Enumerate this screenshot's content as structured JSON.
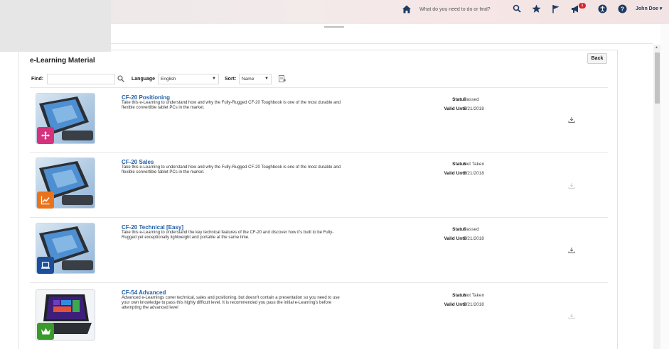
{
  "header": {
    "search_placeholder": "What do you need to do or find?",
    "notification_count": "1",
    "user_name": "John Doe ▾"
  },
  "page": {
    "title": "e-Learning Material",
    "back_label": "Back"
  },
  "filters": {
    "find_label": "Find:",
    "find_value": "",
    "language_label": "Language",
    "language_value": "English",
    "sort_label": "Sort:",
    "sort_value": "Name"
  },
  "meta_labels": {
    "status": "Status",
    "valid_until": "Valid Until"
  },
  "courses": [
    {
      "title": "CF-20 Positioning",
      "description": "Take this e-Learning to understand how and why the Fully-Rugged CF-20 Toughbook is one of the most durable and flexible convertible tablet PCs in the market.",
      "status": "Passed",
      "valid_until": "5/21/2018",
      "badge_icon": "positioning-arrows-icon",
      "badge_color": "#d6317d"
    },
    {
      "title": "CF-20 Sales",
      "description": "Take this e-Learning to understand how and why the Fully-Rugged CF-20 Toughbook is one of the most durable and flexible convertible tablet PCs in the market.",
      "status": "Not Taken",
      "valid_until": "5/21/2018",
      "badge_icon": "sales-chart-icon",
      "badge_color": "#e8731c"
    },
    {
      "title": "CF-20 Technical [Easy]",
      "description": "Take this e-Learning to understand the key technical features of the CF-20 and discover how it's built to be Fully-Rugged yet exceptionally lightweight and portable at the same time.",
      "status": "Passed",
      "valid_until": "5/21/2018",
      "badge_icon": "technical-laptop-icon",
      "badge_color": "#1b4f9c"
    },
    {
      "title": "CF-54 Advanced",
      "description": "Advanced e-Learnings cover technical, sales and positioning, but doesn't contain a presentation so you need to use your own knowledge to pass this highly difficult level. It is recommended you pass the initial e-Learning's before attempting the advanced level",
      "status": "Not Taken",
      "valid_until": "5/21/2018",
      "badge_icon": "advanced-crown-icon",
      "badge_color": "#3a9a2c"
    }
  ],
  "colors": {
    "link": "#1f5fa8",
    "nav_icon": "#1d3c63"
  }
}
